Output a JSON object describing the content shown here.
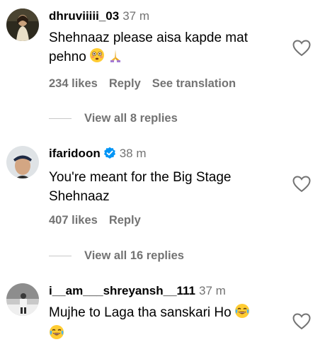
{
  "comments": [
    {
      "username": "dhruviiiii_03",
      "time": "37 m",
      "text_line1": "Shehnaaz please aisa kapde mat",
      "text_line2": "pehno",
      "emojis": [
        "flushed-face-icon",
        "folded-hands-icon"
      ],
      "likes": "234 likes",
      "reply": "Reply",
      "translate": "See translation",
      "view_replies": "View all 8 replies"
    },
    {
      "username": "ifaridoon",
      "verified": true,
      "time": "38 m",
      "text_line1": "You're meant for the Big Stage",
      "text_line2": "Shehnaaz",
      "likes": "407 likes",
      "reply": "Reply",
      "view_replies": "View all 16 replies"
    },
    {
      "username": "i__am___shreyansh__111",
      "time": "37 m",
      "text_line1": "Mujhe to Laga tha sanskari Ho",
      "text_line2": "",
      "emojis": [
        "face-with-tears-of-joy-icon",
        "face-with-tears-of-joy-icon"
      ]
    }
  ],
  "colors": {
    "secondary_text": "#737373",
    "verified_badge": "#0095f6",
    "divider": "#c7c7c7"
  }
}
